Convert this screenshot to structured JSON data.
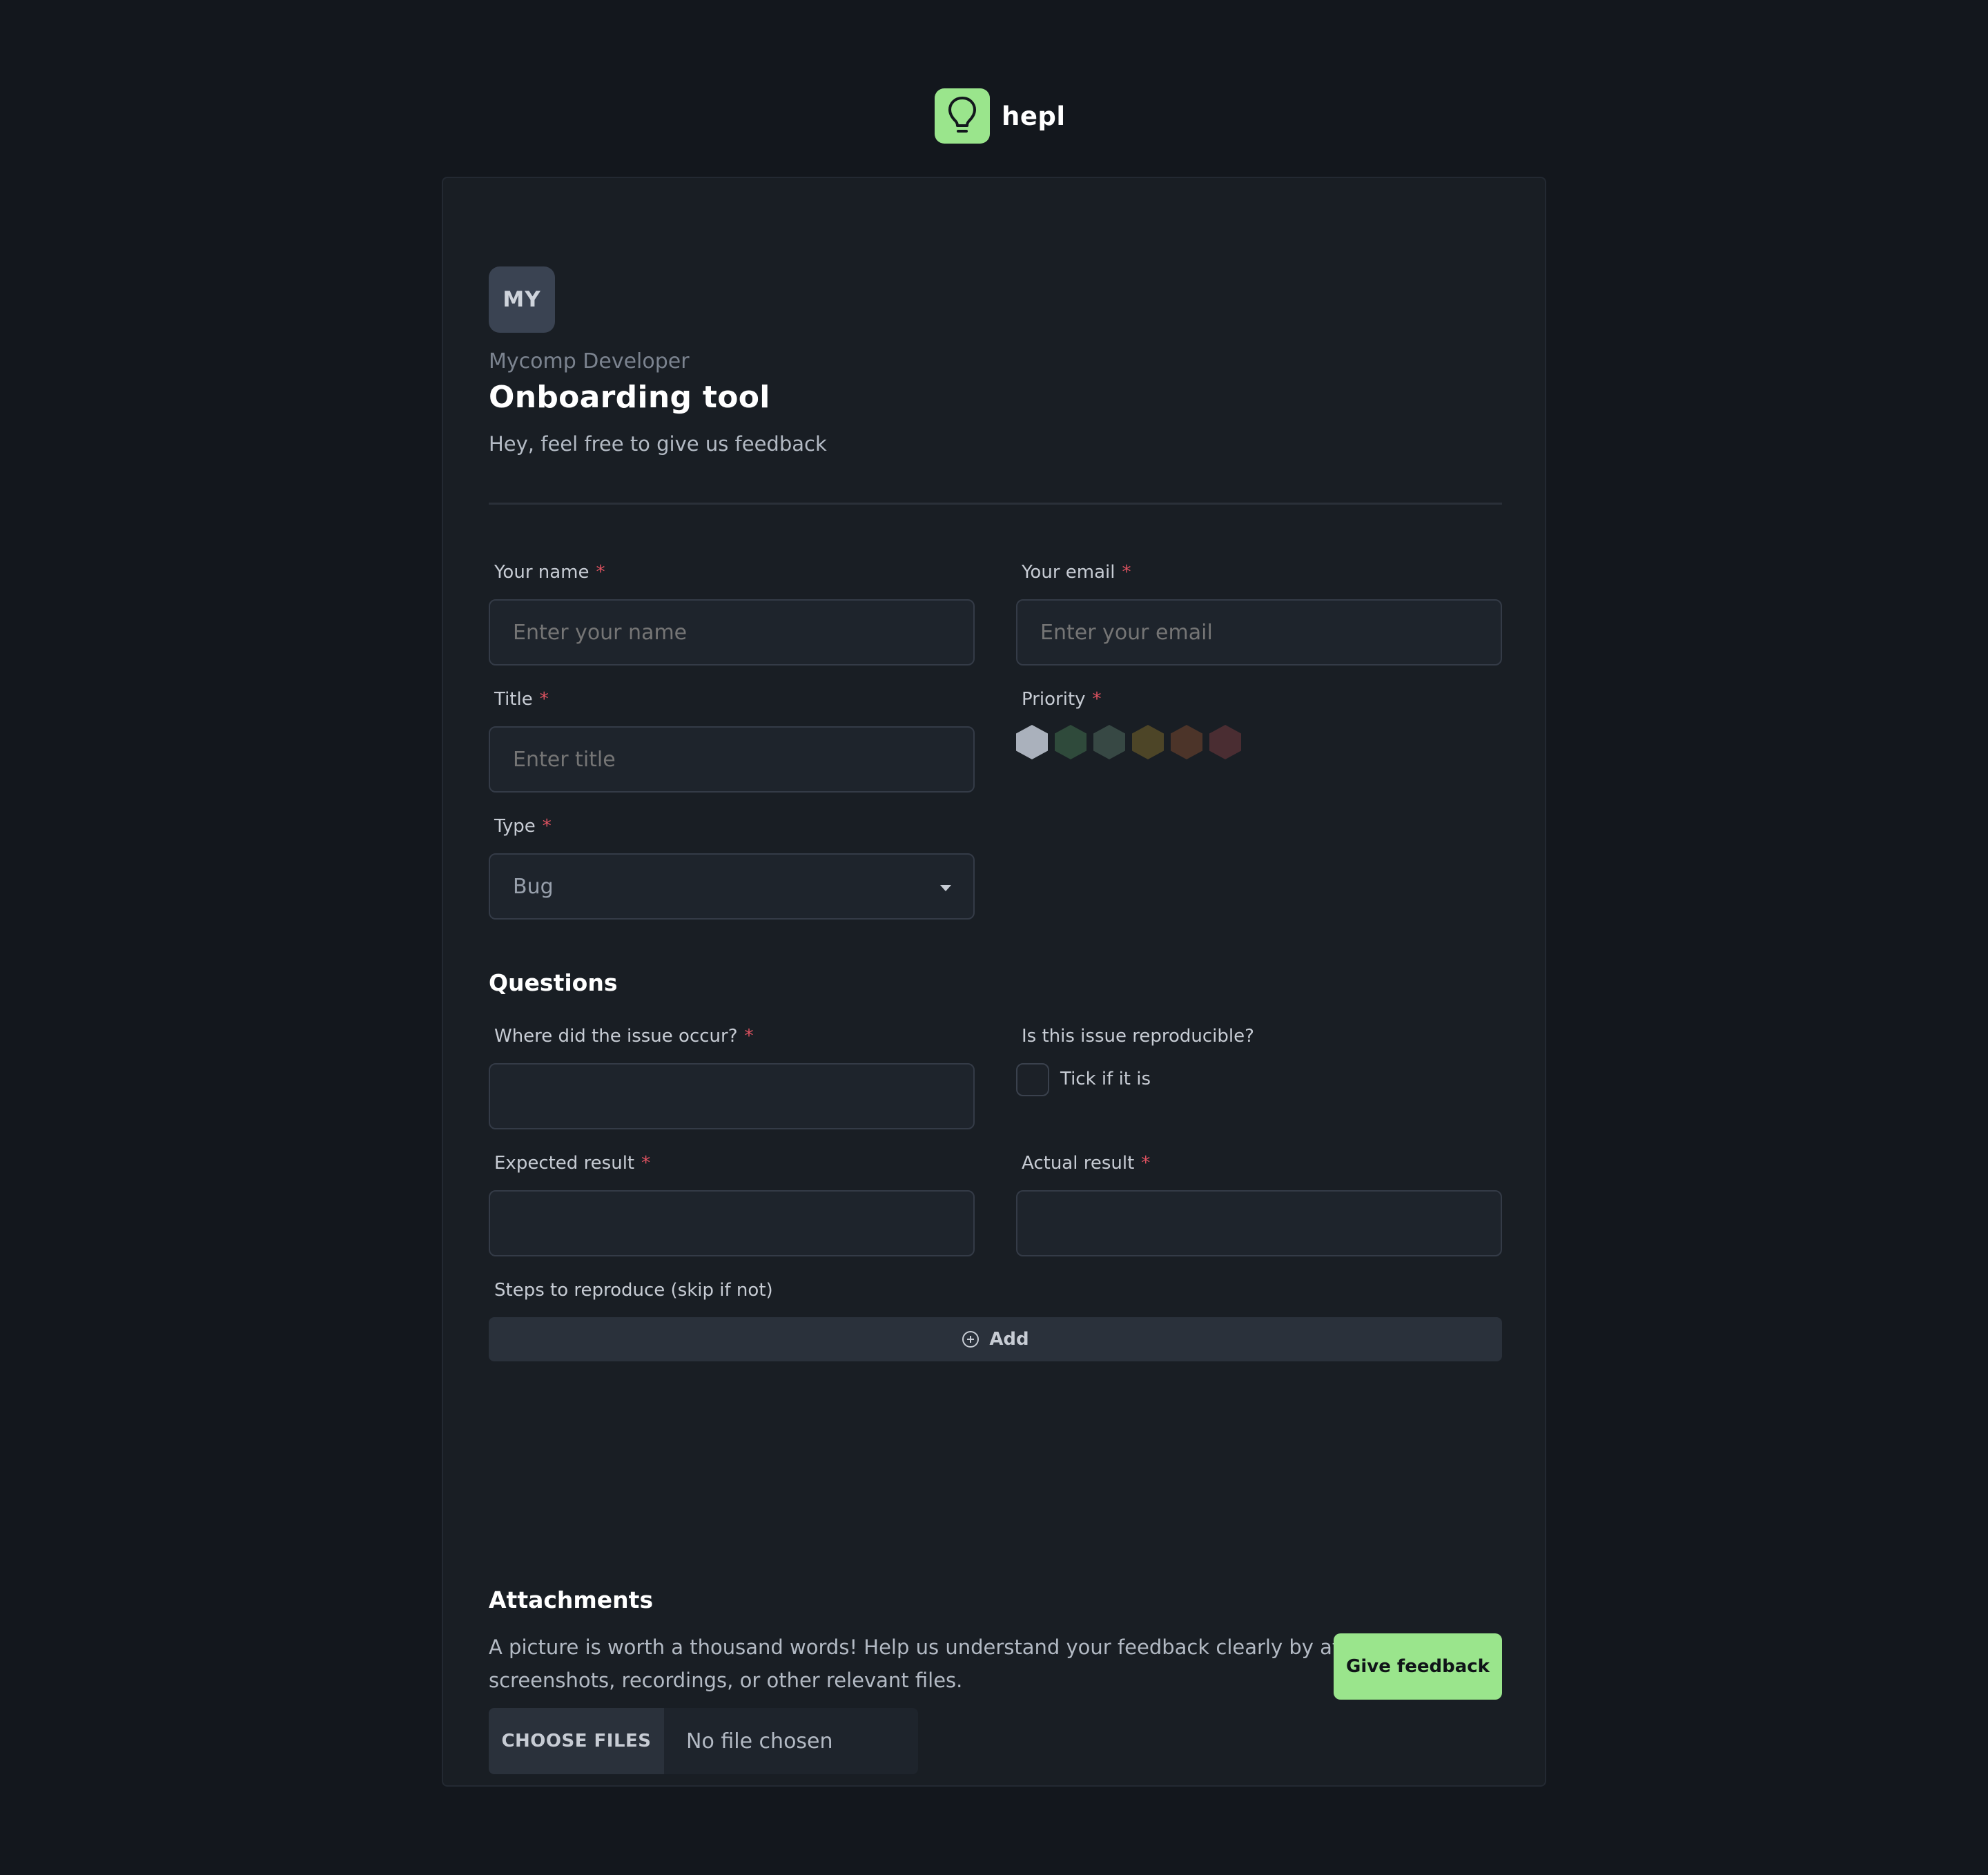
{
  "brand": {
    "name": "hepl",
    "logo_icon": "lightbulb-icon",
    "accent": "#9ae58c"
  },
  "header": {
    "avatar_initials": "MY",
    "org": "Mycomp Developer",
    "title": "Onboarding tool",
    "subtitle": "Hey, feel free to give us feedback"
  },
  "form": {
    "name": {
      "label": "Your name",
      "required": "*",
      "placeholder": "Enter your name"
    },
    "email": {
      "label": "Your email",
      "required": "*",
      "placeholder": "Enter your email"
    },
    "title": {
      "label": "Title",
      "required": "*",
      "placeholder": "Enter title"
    },
    "priority": {
      "label": "Priority",
      "required": "*",
      "options": [
        {
          "color": "#aab1bc"
        },
        {
          "color": "#2f4a3b"
        },
        {
          "color": "#374844"
        },
        {
          "color": "#4d4527"
        },
        {
          "color": "#4c3429"
        },
        {
          "color": "#4a2d32"
        }
      ]
    },
    "type": {
      "label": "Type",
      "required": "*",
      "value": "Bug"
    }
  },
  "questions": {
    "heading": "Questions",
    "where": {
      "label": "Where did the issue occur?",
      "required": "*",
      "value": ""
    },
    "reproducible": {
      "label": "Is this issue reproducible?",
      "checkbox_label": "Tick if it is"
    },
    "expected": {
      "label": "Expected result",
      "required": "*",
      "value": ""
    },
    "actual": {
      "label": "Actual result",
      "required": "*",
      "value": ""
    },
    "steps": {
      "label": "Steps to reproduce (skip if not)",
      "add_label": "Add"
    }
  },
  "attachments": {
    "heading": "Attachments",
    "description": "A picture is worth a thousand words! Help us understand your feedback clearly by attaching screenshots, recordings, or other relevant files.",
    "choose_label": "CHOOSE FILES",
    "status": "No file chosen"
  },
  "submit_label": "Give feedback"
}
